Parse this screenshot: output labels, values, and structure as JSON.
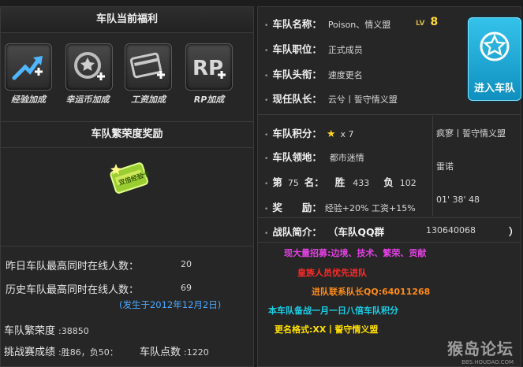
{
  "left": {
    "welfare_title": "车队当前福利",
    "bonuses": [
      {
        "label": "经验加成",
        "icon": "exp-bonus-icon"
      },
      {
        "label": "幸运币加成",
        "icon": "coin-bonus-icon"
      },
      {
        "label": "工资加成",
        "icon": "salary-bonus-icon"
      },
      {
        "label": "RP加成",
        "icon": "rp-bonus-icon"
      }
    ],
    "prosperity_title": "车队繁荣度奖励",
    "reward_card_text": "双倍经验卡",
    "stats": {
      "yesterday_label": "昨日车队最高同时在线人数：",
      "yesterday_value": "20",
      "history_label": "历史车队最高同时在线人数：",
      "history_value": "69",
      "history_note": "(发生于2012年12月2日)",
      "prosperity_label": "车队繁荣度",
      "prosperity_value": ":38850",
      "challenge_label": "挑战赛成绩",
      "challenge_value": ":胜86，负50：",
      "points_label": "车队点数",
      "points_value": ":1220"
    }
  },
  "right": {
    "name_label": "车队名称：",
    "name_value": "Poison、情义盟",
    "lv_label": "LV",
    "lv_value": "8",
    "position_label": "车队职位：",
    "position_value": "正式成员",
    "title_label": "车队头衔：",
    "title_value": "速度更名",
    "captain_label": "现任队长：",
    "captain_value": "云兮丨誓守情义盟",
    "enter_button": "进入车队",
    "score_label": "车队积分：",
    "score_value": "x 7",
    "territory_label": "车队领地：",
    "territory_value": "都市迷情",
    "rank_prefix": "第",
    "rank_value": "75",
    "rank_suffix": "名：",
    "win_label": "胜",
    "win_value": "433",
    "lose_label": "负",
    "lose_value": "102",
    "reward_label": "奖　　励：",
    "reward_value": "经验+20% 工资+15%",
    "side_list": [
      "疯寥丨誓守情义盟",
      "雷诺",
      "01' 38' 48"
    ],
    "intro_label": "战队简介：",
    "intro_value": "（车队QQ群",
    "intro_qq": "130640068",
    "intro_close": "）",
    "ad_lines": [
      {
        "text": "现大量招募:边境、技术、繁荣、贡献",
        "color": "#e040e0"
      },
      {
        "text": "皇族人员优先进队",
        "color": "#ff2a2a"
      },
      {
        "text": "进队联系队长QQ:64011268",
        "color": "#ff8a1a"
      },
      {
        "text": "本车队备战一月一日八倍车队积分",
        "color": "#18d0e8"
      },
      {
        "text": "更名格式:XX丨誓守情义盟",
        "color": "#ffe000"
      }
    ],
    "watermark": "猴岛论坛",
    "watermark_url": "BBS.HOUDAO.COM"
  }
}
